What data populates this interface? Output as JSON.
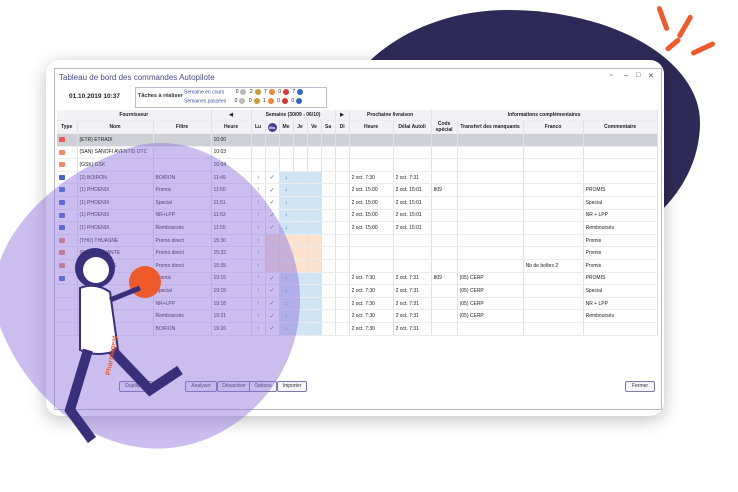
{
  "window": {
    "title": "Tableau de bord des commandes Autopilote",
    "controls": [
      "▫",
      "–",
      "□",
      "✕"
    ]
  },
  "header": {
    "date": "01.10.2019 10:37",
    "tasks_label": "Tâches à réaliser",
    "rows": [
      {
        "label": "Semaine en cours",
        "values": [
          "0",
          "2",
          "7",
          "0",
          "7"
        ]
      },
      {
        "label": "Semaines passées",
        "values": [
          "0",
          "0",
          "1",
          "0",
          "0"
        ]
      }
    ]
  },
  "columns": {
    "group_fournisseur": "Fournisseur",
    "group_semaine": "Semaine (30/09 - 06/10)",
    "group_livraison": "Prochaine livraison",
    "group_infos": "Informations complémentaires",
    "type": "Type",
    "nom": "Nom",
    "filtre": "Filtre",
    "heure": "Heure",
    "days": [
      "Lu",
      "Ma",
      "Me",
      "Je",
      "Ve",
      "Sa",
      "Di"
    ],
    "liv_heure": "Heure",
    "delai": "Délai Autoli",
    "code": "Code spécial",
    "transfert": "Transfert des manquants",
    "franco": "Franco",
    "commentaire": "Commentaire"
  },
  "rows": [
    {
      "nom": "(ETR) ETRADI",
      "filtre": "",
      "heure": "10:00",
      "liv": "",
      "delai": "",
      "code": "",
      "transfert": "",
      "franco": "",
      "comment": "",
      "icon": "#e55"
    },
    {
      "nom": "(SAN) SANOFI AVENTIS OTC",
      "filtre": "",
      "heure": "10:03",
      "liv": "",
      "delai": "",
      "code": "",
      "transfert": "",
      "franco": "",
      "comment": "",
      "icon": "#e86"
    },
    {
      "nom": "(GSK) GSK",
      "filtre": "",
      "heure": "10:04",
      "liv": "",
      "delai": "",
      "code": "",
      "transfert": "",
      "franco": "",
      "comment": "",
      "icon": "#e86"
    },
    {
      "nom": "(2) BOIRON",
      "filtre": "BOIRON",
      "heure": "11:49",
      "liv": "2 oct. 7:30",
      "delai": "2 oct. 7:31",
      "code": "",
      "transfert": "",
      "franco": "",
      "comment": "",
      "icon": "#46c"
    },
    {
      "nom": "(1) PHOENIX",
      "filtre": "Promis",
      "heure": "11:50",
      "liv": "2 oct. 15:00",
      "delai": "2 oct. 15:01",
      "code": "809",
      "transfert": "",
      "franco": "",
      "comment": "PROMIS",
      "icon": "#46c"
    },
    {
      "nom": "(1) PHOENIX",
      "filtre": "Special",
      "heure": "11:51",
      "liv": "2 oct. 15:00",
      "delai": "2 oct. 15:01",
      "code": "",
      "transfert": "",
      "franco": "",
      "comment": "Special",
      "icon": "#46c"
    },
    {
      "nom": "(1) PHOENIX",
      "filtre": "NR+LPP",
      "heure": "11:53",
      "liv": "2 oct. 15:00",
      "delai": "2 oct. 15:01",
      "code": "",
      "transfert": "",
      "franco": "",
      "comment": "NR + LPP",
      "icon": "#46c"
    },
    {
      "nom": "(1) PHOENIX",
      "filtre": "Remboursés",
      "heure": "11:55",
      "liv": "2 oct. 15:00",
      "delai": "2 oct. 15:01",
      "code": "",
      "transfert": "",
      "franco": "",
      "comment": "Remboursés",
      "icon": "#46c"
    },
    {
      "nom": "(THU) THUASNE",
      "filtre": "Promo direct",
      "heure": "15:30",
      "liv": "",
      "delai": "",
      "code": "",
      "transfert": "",
      "franco": "",
      "comment": "Promis",
      "icon": "#e86"
    },
    {
      "nom": "(RAD) RADIANTE",
      "filtre": "Promo direct",
      "heure": "15:32",
      "liv": "",
      "delai": "",
      "code": "",
      "transfert": "",
      "franco": "",
      "comment": "Promis",
      "icon": "#e86"
    },
    {
      "nom": "(SIG) SIGVARIS",
      "filtre": "Promo direct",
      "heure": "15:35",
      "liv": "",
      "delai": "",
      "code": "",
      "transfert": "",
      "franco": "Nb de boîtes 2",
      "comment": "Promis",
      "icon": "#e86"
    },
    {
      "nom": "(1) PHOENIX",
      "filtre": "Promis",
      "heure": "19:15",
      "liv": "2 oct. 7:30",
      "delai": "2 oct. 7:31",
      "code": "809",
      "transfert": "(05) CERP",
      "franco": "",
      "comment": "PROMIS",
      "icon": "#46c"
    },
    {
      "nom": "",
      "filtre": "Special",
      "heure": "19:15",
      "liv": "2 oct. 7:30",
      "delai": "2 oct. 7:31",
      "code": "",
      "transfert": "(05) CERP",
      "franco": "",
      "comment": "Special",
      "icon": ""
    },
    {
      "nom": "",
      "filtre": "NR+LPP",
      "heure": "19:18",
      "liv": "2 oct. 7:30",
      "delai": "2 oct. 7:31",
      "code": "",
      "transfert": "(05) CERP",
      "franco": "",
      "comment": "NR + LPP",
      "icon": ""
    },
    {
      "nom": "",
      "filtre": "Remboursés",
      "heure": "19:21",
      "liv": "2 oct. 7:30",
      "delai": "2 oct. 7:31",
      "code": "",
      "transfert": "(05) CERP",
      "franco": "",
      "comment": "Remboursés",
      "icon": ""
    },
    {
      "nom": "",
      "filtre": "BOIRON",
      "heure": "19:26",
      "liv": "2 oct. 7:30",
      "delai": "2 oct. 7:31",
      "code": "",
      "transfert": "",
      "franco": "",
      "comment": "",
      "icon": ""
    }
  ],
  "buttons": [
    "Dupliquer",
    "Analyser",
    "Désactiver",
    "Options",
    "Importer",
    "Fermer"
  ],
  "brand": {
    "mascot_text": "Pharmagest"
  }
}
